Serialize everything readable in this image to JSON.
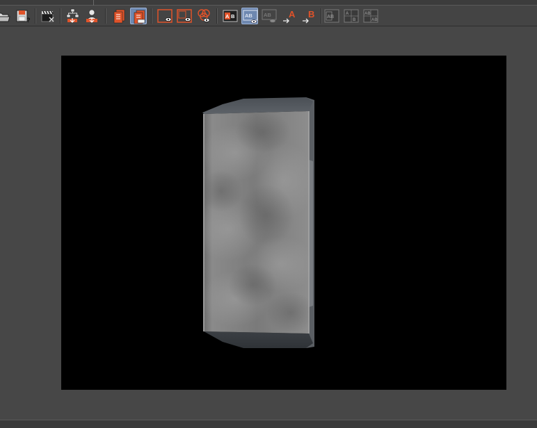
{
  "toolbar": {
    "buttons": [
      {
        "id": "open",
        "icon": "folder-open-icon"
      },
      {
        "id": "save",
        "icon": "save-disk-icon"
      },
      {
        "id": "clapper",
        "icon": "clapperboard-icon"
      },
      {
        "id": "import-tree",
        "icon": "tree-import-icon"
      },
      {
        "id": "import-user",
        "icon": "user-import-icon"
      },
      {
        "id": "layer-a",
        "icon": "layers-icon"
      },
      {
        "id": "layer-b",
        "icon": "layers-edit-icon",
        "active": true
      },
      {
        "id": "view-1",
        "icon": "view-eye-icon"
      },
      {
        "id": "view-2",
        "icon": "view-eye-icon"
      },
      {
        "id": "view-3",
        "icon": "view-eye-multi-icon"
      },
      {
        "id": "ab-1",
        "icon": "ab-compare-icon"
      },
      {
        "id": "ab-2",
        "icon": "ab-compare-eye-icon",
        "active": true
      },
      {
        "id": "ab-3",
        "icon": "ab-compare-disabled-icon"
      },
      {
        "id": "set-a",
        "icon": "set-a-icon"
      },
      {
        "id": "set-b",
        "icon": "set-b-icon"
      },
      {
        "id": "grid-1",
        "icon": "ab-grid-icon"
      },
      {
        "id": "grid-2",
        "icon": "ab-grid-icon"
      },
      {
        "id": "grid-3",
        "icon": "ab-grid-icon"
      }
    ],
    "glyphs": {
      "ab": "AB",
      "a": "A",
      "b": "B"
    }
  },
  "colors": {
    "accent_orange": "#e0532a",
    "active_blue": "#6e88b0",
    "background": "#474747",
    "viewport": "#000000"
  }
}
